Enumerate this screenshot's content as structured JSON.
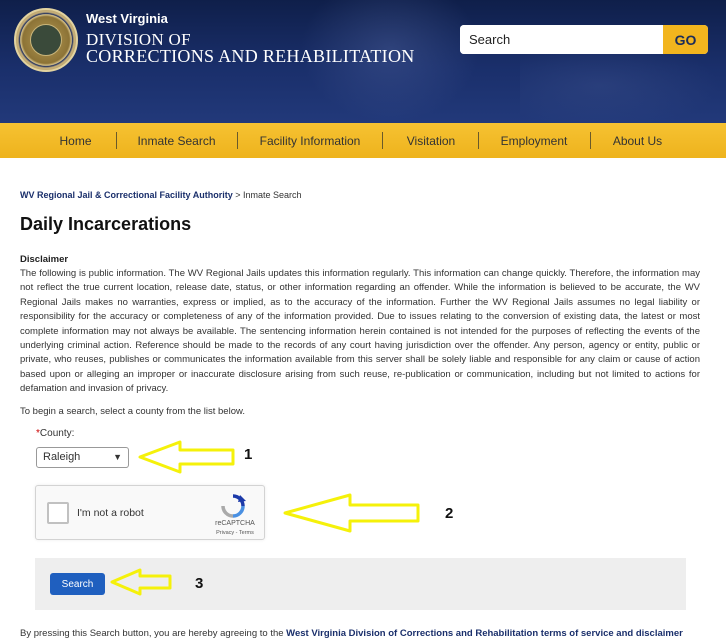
{
  "header": {
    "agency_state": "West Virginia",
    "agency_line1": "DIVISION OF",
    "agency_line2": "CORRECTIONS AND REHABILITATION",
    "search": {
      "placeholder": "Search",
      "button_label": "GO"
    }
  },
  "nav": {
    "items": [
      {
        "label": "Home"
      },
      {
        "label": "Inmate Search"
      },
      {
        "label": "Facility Information"
      },
      {
        "label": "Visitation"
      },
      {
        "label": "Employment"
      },
      {
        "label": "About Us"
      }
    ]
  },
  "breadcrumb": {
    "parent": "WV Regional Jail & Correctional Facility Authority",
    "separator": " > ",
    "current": "Inmate Search"
  },
  "page_title": "Daily Incarcerations",
  "disclaimer": {
    "heading": "Disclaimer",
    "text": "The following is public information. The WV Regional Jails updates this information regularly. This information can change quickly. Therefore, the information may not reflect the true current location, release date, status, or other information regarding an offender. While the information is believed to be accurate, the WV Regional Jails makes no warranties, express or implied, as to the accuracy of the information. Further the WV Regional Jails assumes no legal liability or responsibility for the accuracy or completeness of any of the information provided. Due to issues relating to the conversion of existing data, the latest or most complete information may not always be available. The sentencing information herein contained is not intended for the purposes of reflecting the events of the underlying criminal action. Reference should be made to the records of any court having jurisdiction over the offender. Any person, agency or entity, public or private, who reuses, publishes or communicates the information available from this server shall be solely liable and responsible for any claim or cause of action based upon or alleging an improper or inaccurate disclosure arising from such reuse, re-publication or communication, including but not limited to actions for defamation and invasion of privacy."
  },
  "instruction": "To begin a search, select a county from the list below.",
  "county": {
    "required_mark": "*",
    "label": "County:",
    "selected": "Raleigh"
  },
  "captcha": {
    "label": "I'm not a robot",
    "brand": "reCAPTCHA",
    "links": "Privacy - Terms"
  },
  "search_button_label": "Search",
  "agreement": {
    "text": "By pressing this Search button, you are hereby agreeing to the ",
    "link": "West Virginia Division of Corrections and Rehabilitation terms of service and disclaimer"
  },
  "annotations": [
    {
      "number": "1"
    },
    {
      "number": "2"
    },
    {
      "number": "3"
    }
  ],
  "colors": {
    "header_navy": "#1a2f6b",
    "nav_gold": "#f2b51e",
    "search_button_blue": "#1f5fbf",
    "annotation_arrow_yellow": "#f5f10a"
  }
}
